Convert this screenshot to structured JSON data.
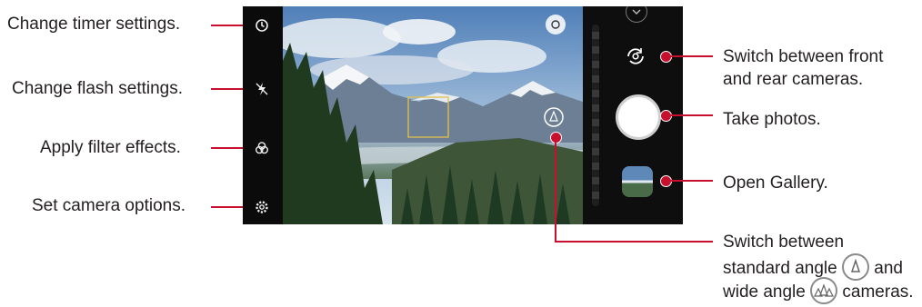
{
  "callouts": {
    "timer": "Change timer settings.",
    "flash": "Change flash settings.",
    "filter": "Apply filter effects.",
    "options": "Set camera options.",
    "switch_line1": "Switch between front",
    "switch_line2": "and rear cameras.",
    "take_photos": "Take photos.",
    "gallery": "Open Gallery.",
    "angle_line1": "Switch between",
    "angle_line2a": "standard angle",
    "angle_line2b": "and",
    "angle_line3a": "wide angle",
    "angle_line3b": "cameras."
  },
  "icons": {
    "timer": "timer-icon",
    "flash": "flash-off-icon",
    "filter": "filter-icon",
    "options": "settings-icon",
    "switch_camera": "switch-camera-icon",
    "shutter": "shutter-button",
    "gallery": "gallery-thumbnail",
    "standard_angle": "standard-angle-icon",
    "wide_angle": "wide-angle-icon",
    "focus": "focus-icon",
    "chevron": "chevron-down-icon"
  },
  "colors": {
    "callout_line": "#c8102e",
    "camera_bar": "#0e0e0e",
    "shutter": "#ffffff"
  }
}
